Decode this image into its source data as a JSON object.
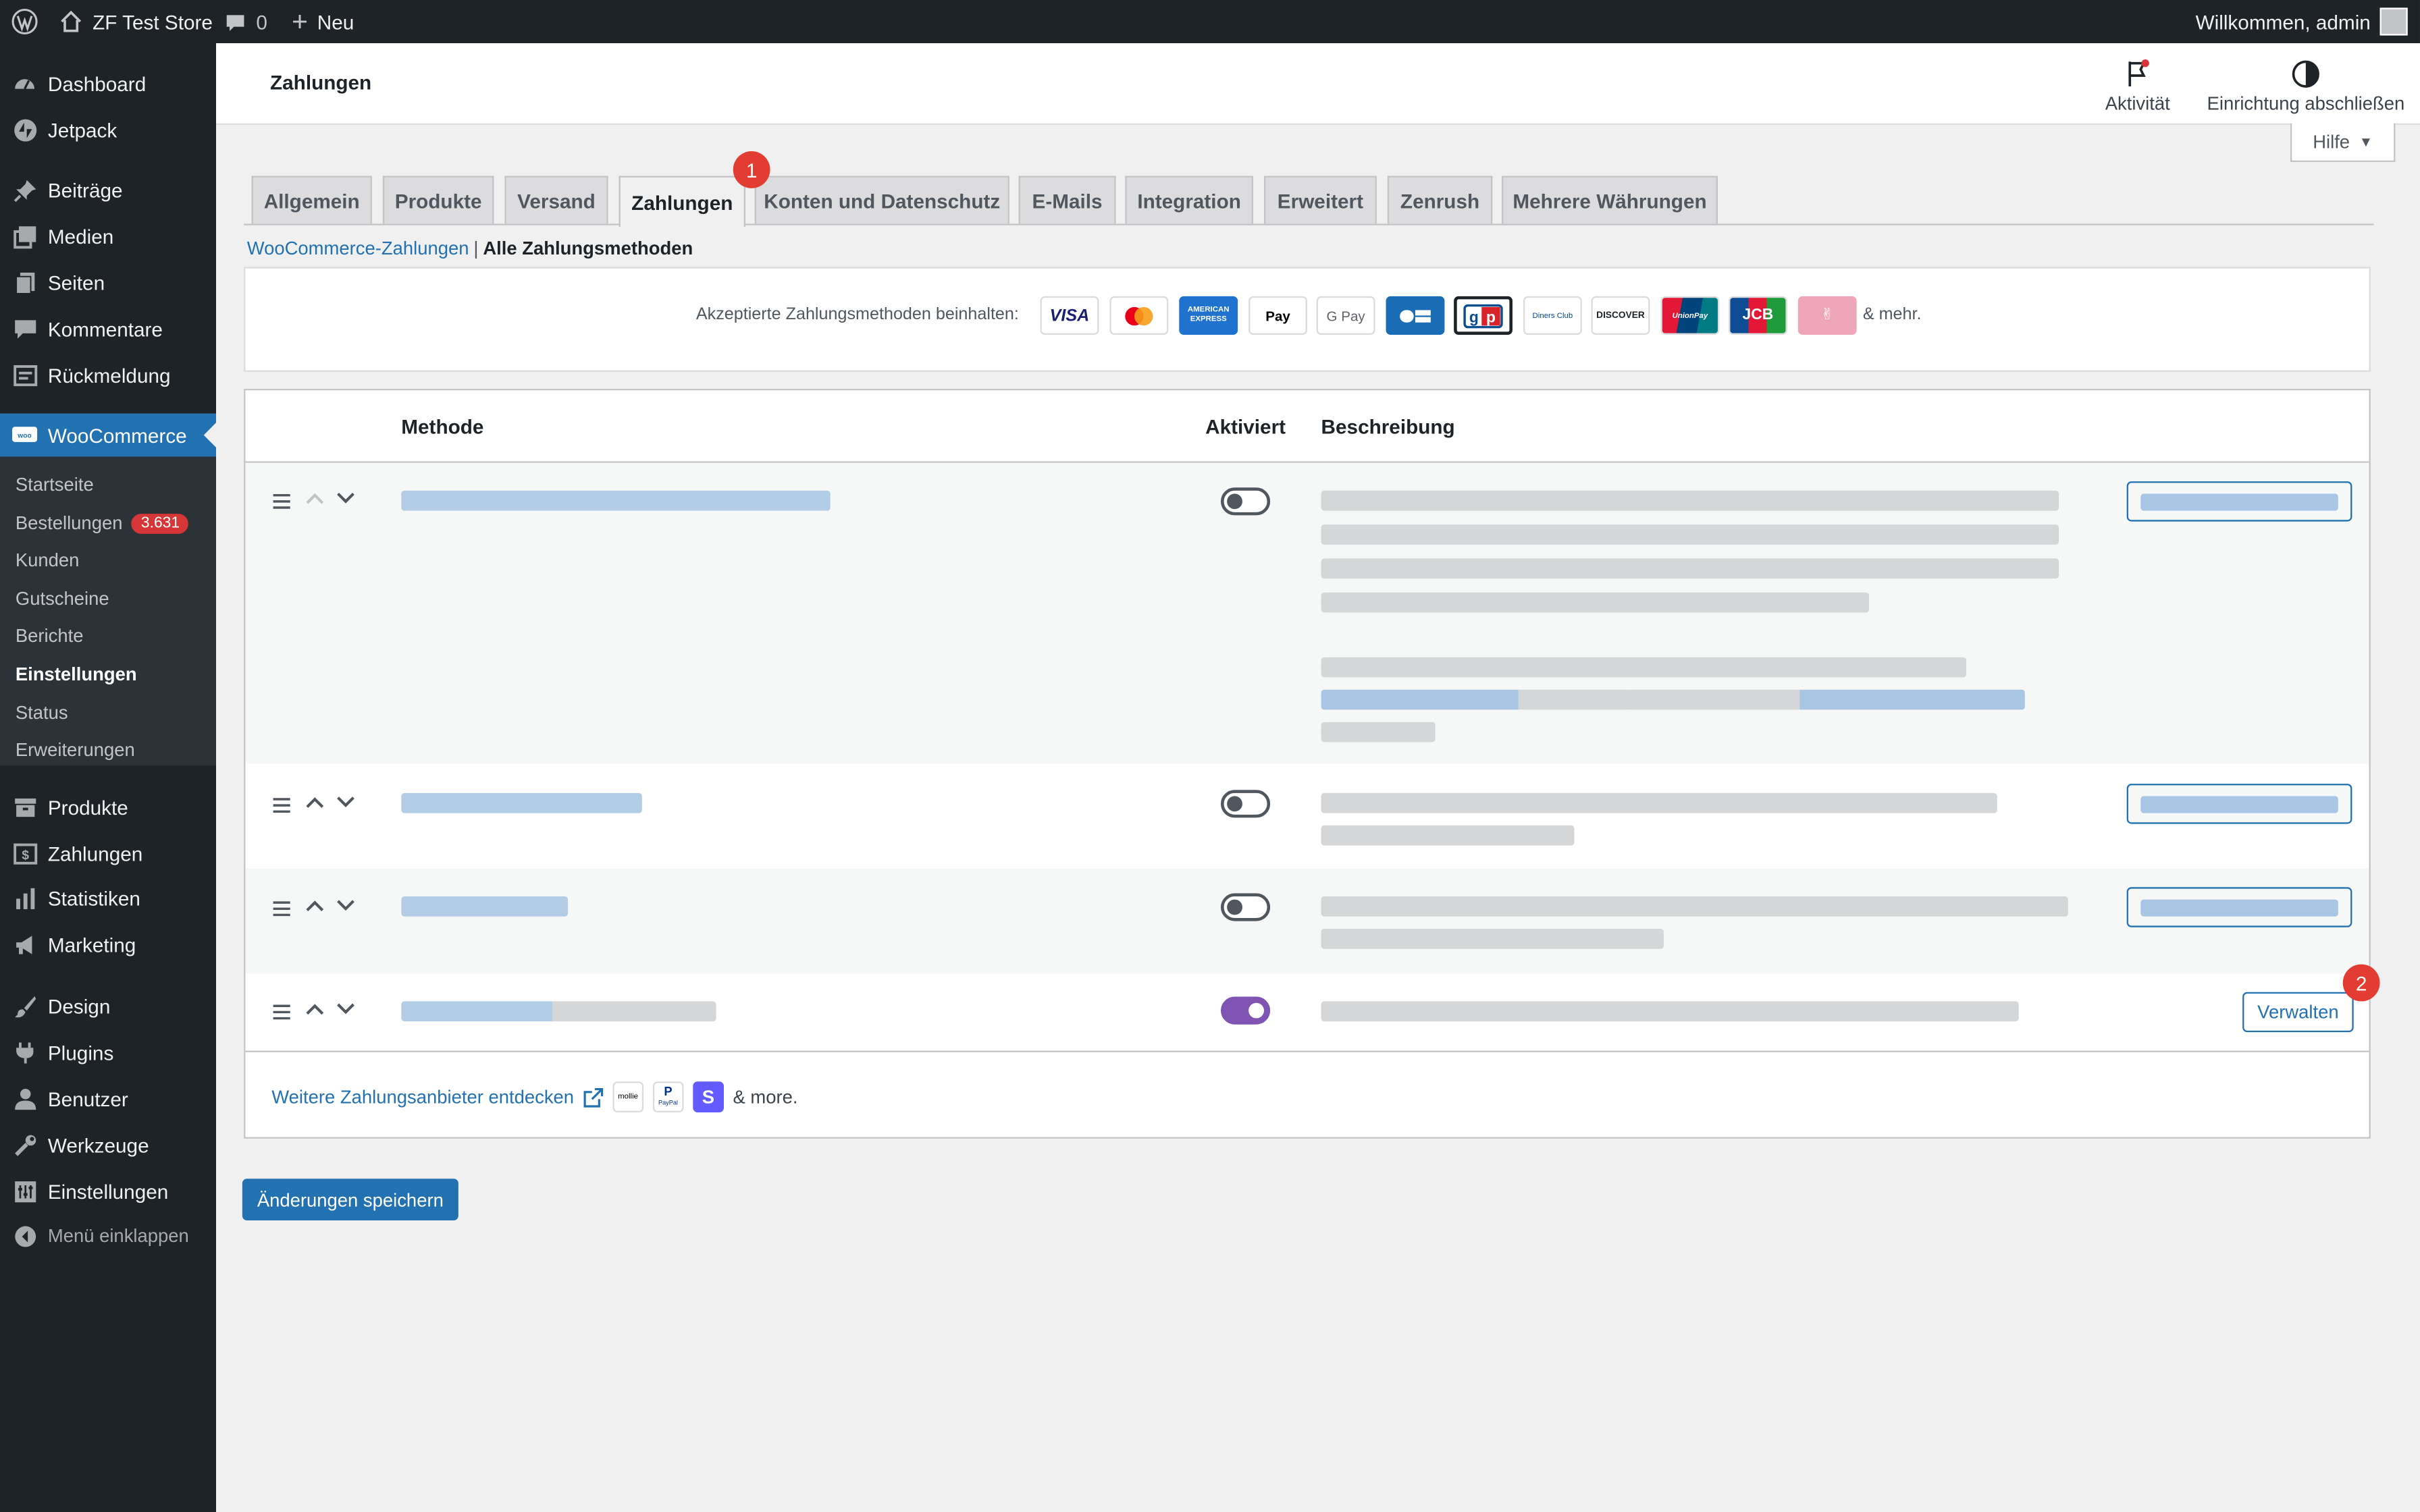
{
  "adminbar": {
    "site_name": "ZF Test Store",
    "comments_count": "0",
    "new_label": "Neu",
    "welcome": "Willkommen, admin"
  },
  "sidebar": {
    "items": [
      {
        "label": "Dashboard",
        "icon": "dashboard-icon"
      },
      {
        "label": "Jetpack",
        "icon": "jetpack-icon"
      },
      {
        "label": "Beiträge",
        "icon": "pin-icon"
      },
      {
        "label": "Medien",
        "icon": "media-icon"
      },
      {
        "label": "Seiten",
        "icon": "pages-icon"
      },
      {
        "label": "Kommentare",
        "icon": "comment-icon"
      },
      {
        "label": "Rückmeldung",
        "icon": "feedback-icon"
      },
      {
        "label": "WooCommerce",
        "icon": "woo-icon"
      },
      {
        "label": "Produkte",
        "icon": "archive-icon"
      },
      {
        "label": "Zahlungen",
        "icon": "money-icon"
      },
      {
        "label": "Statistiken",
        "icon": "chart-icon"
      },
      {
        "label": "Marketing",
        "icon": "megaphone-icon"
      },
      {
        "label": "Design",
        "icon": "brush-icon"
      },
      {
        "label": "Plugins",
        "icon": "plugin-icon"
      },
      {
        "label": "Benutzer",
        "icon": "user-icon"
      },
      {
        "label": "Werkzeuge",
        "icon": "wrench-icon"
      },
      {
        "label": "Einstellungen",
        "icon": "settings-icon"
      },
      {
        "label": "Menü einklappen",
        "icon": "collapse-icon"
      }
    ],
    "submenu": [
      {
        "label": "Startseite"
      },
      {
        "label": "Bestellungen",
        "count": "3.631"
      },
      {
        "label": "Kunden"
      },
      {
        "label": "Gutscheine"
      },
      {
        "label": "Berichte"
      },
      {
        "label": "Einstellungen",
        "active": true
      },
      {
        "label": "Status"
      },
      {
        "label": "Erweiterungen"
      }
    ]
  },
  "header": {
    "title": "Zahlungen",
    "activity_label": "Aktivität",
    "setup_label": "Einrichtung abschließen",
    "help_label": "Hilfe"
  },
  "tabs": [
    {
      "label": "Allgemein"
    },
    {
      "label": "Produkte"
    },
    {
      "label": "Versand"
    },
    {
      "label": "Zahlungen",
      "active": true
    },
    {
      "label": "Konten und Datenschutz"
    },
    {
      "label": "E-Mails"
    },
    {
      "label": "Integration"
    },
    {
      "label": "Erweitert"
    },
    {
      "label": "Zenrush"
    },
    {
      "label": "Mehrere Währungen"
    }
  ],
  "annotations": {
    "tab_badge": "1",
    "manage_badge": "2"
  },
  "breadcrumb": {
    "link": "WooCommerce-Zahlungen",
    "separator": "|",
    "current": "Alle Zahlungsmethoden"
  },
  "accepted": {
    "label": "Akzeptierte Zahlungsmethoden beinhalten:",
    "logos": [
      "VISA",
      "Mastercard",
      "AMERICAN EXPRESS",
      "Apple Pay",
      "G Pay",
      "CB",
      "gp",
      "Diners Club",
      "DISCOVER",
      "UnionPay",
      "JCB",
      "Afterpay"
    ],
    "more": "& mehr."
  },
  "table": {
    "col_method": "Methode",
    "col_enabled": "Aktiviert",
    "col_description": "Beschreibung",
    "rows": [
      {
        "enabled": false
      },
      {
        "enabled": false
      },
      {
        "enabled": false
      },
      {
        "enabled": true,
        "manage_label": "Verwalten"
      }
    ],
    "footer_link": "Weitere Zahlungsanbieter entdecken",
    "footer_logos": [
      "mollie",
      "PayPal",
      "S"
    ],
    "footer_more": "& more."
  },
  "save_button": "Änderungen speichern",
  "colors": {
    "admin_dark": "#1d2327",
    "accent": "#2271b1",
    "toggle_on": "#7f54b3",
    "badge_red": "#e33c32"
  }
}
